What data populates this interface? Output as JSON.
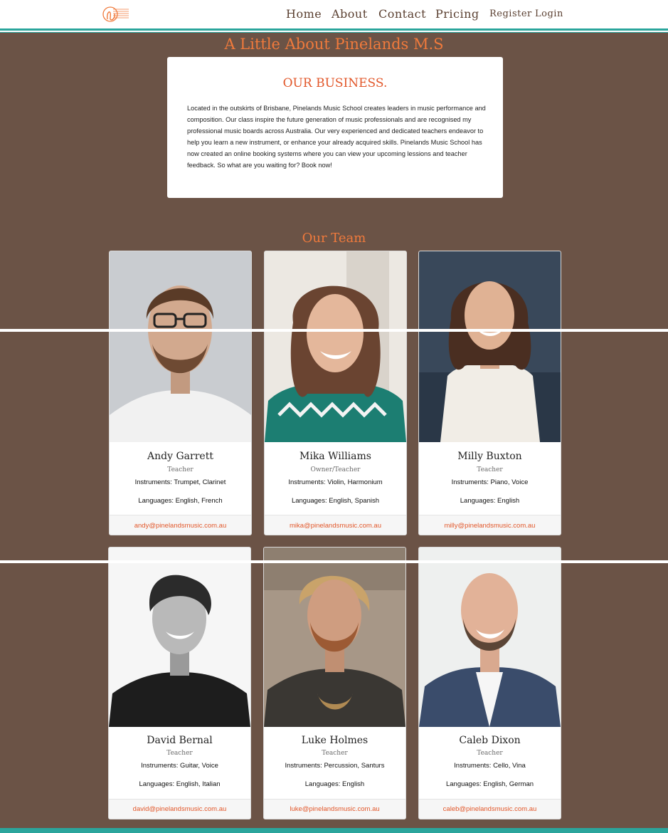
{
  "nav": {
    "links": [
      "Home",
      "About",
      "Contact",
      "Pricing"
    ],
    "register": "Register",
    "login": "Login"
  },
  "page_title": "A Little About Pinelands M.S",
  "about": {
    "heading": "OUR BUSINESS.",
    "text": "Located in the outskirts of Brisbane, Pinelands Music School creates leaders in music performance and composition. Our class inspire the future generation of music professionals and are recognised my professional music boards across Australia. Our very experienced and dedicated teachers endeavor to help you learn a new instrument, or enhance your already acquired skills. Pinelands Music School has now created an online booking systems where you can view your upcoming lessions and teacher feedback. So what are you waiting for? Book now!"
  },
  "team_heading": "Our Team",
  "team": [
    {
      "name": "Andy Garrett",
      "role": "Teacher",
      "instruments": "Instruments: Trumpet, Clarinet",
      "languages": "Languages: English, French",
      "email": "andy@pinelandsmusic.com.au"
    },
    {
      "name": "Mika Williams",
      "role": "Owner/Teacher",
      "instruments": "Instruments: Violin, Harmonium",
      "languages": "Languages: English, Spanish",
      "email": "mika@pinelandsmusic.com.au"
    },
    {
      "name": "Milly Buxton",
      "role": "Teacher",
      "instruments": "Instruments: Piano, Voice",
      "languages": "Languages: English",
      "email": "milly@pinelandsmusic.com.au"
    },
    {
      "name": "David Bernal",
      "role": "Teacher",
      "instruments": "Instruments: Guitar, Voice",
      "languages": "Languages: English, Italian",
      "email": "david@pinelandsmusic.com.au"
    },
    {
      "name": "Luke Holmes",
      "role": "Teacher",
      "instruments": "Instruments: Percussion, Santurs",
      "languages": "Languages: English",
      "email": "luke@pinelandsmusic.com.au"
    },
    {
      "name": "Caleb Dixon",
      "role": "Teacher",
      "instruments": "Instruments: Cello, Vina",
      "languages": "Languages: English, German",
      "email": "caleb@pinelandsmusic.com.au"
    }
  ]
}
